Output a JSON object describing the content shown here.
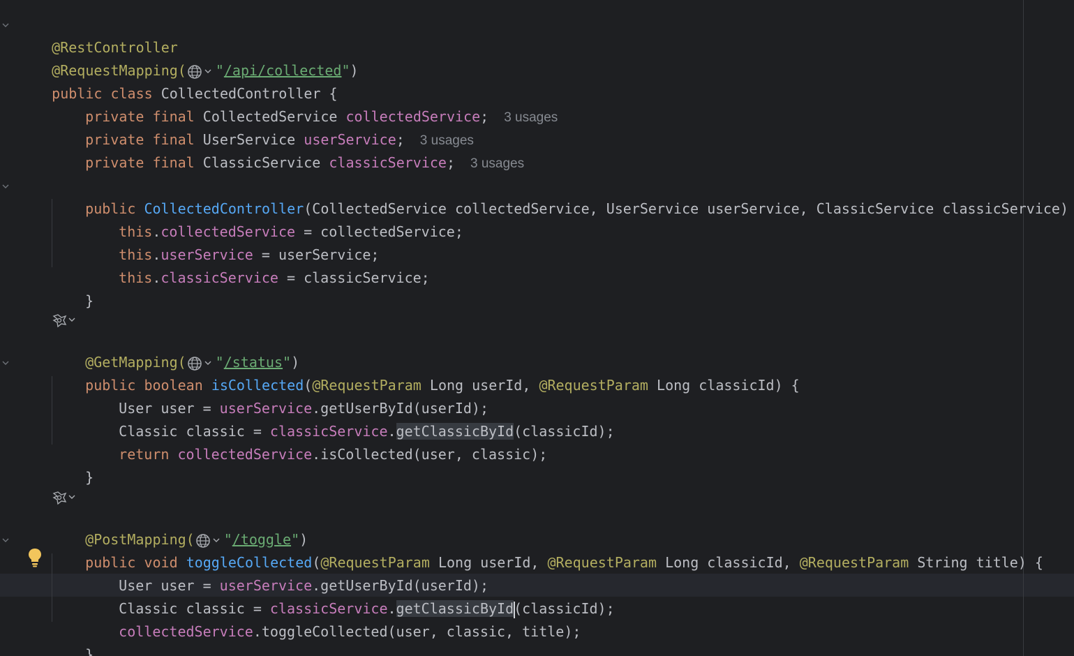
{
  "editor": {
    "language": "java",
    "lines": {
      "l1": [
        "@RestController"
      ],
      "l2": [
        "@RequestMapping(",
        "\"",
        "/api/collected",
        "\"",
        ")"
      ],
      "l3": [
        "public",
        " ",
        "class",
        " CollectedController {"
      ],
      "l4": [
        "private",
        " ",
        "final",
        " CollectedService ",
        "collectedService",
        ";"
      ],
      "l5": [
        "private",
        " ",
        "final",
        " UserService ",
        "userService",
        ";"
      ],
      "l6": [
        "private",
        " ",
        "final",
        " ClassicService ",
        "classicService",
        ";"
      ],
      "l8": [
        "public",
        " ",
        "CollectedController",
        "(CollectedService collectedService, UserService userService, ClassicService classicService) {"
      ],
      "l9": [
        "this",
        ".",
        "collectedService",
        " = collectedService;"
      ],
      "l10": [
        "this",
        ".",
        "userService",
        " = userService;"
      ],
      "l11": [
        "this",
        ".",
        "classicService",
        " = classicService;"
      ],
      "l12": [
        "}"
      ],
      "l14": [
        "@GetMapping(",
        "\"",
        "/status",
        "\"",
        ")"
      ],
      "l15": [
        "public",
        " ",
        "boolean",
        " ",
        "isCollected",
        "(",
        "@RequestParam",
        " Long userId, ",
        "@RequestParam",
        " Long classicId) {"
      ],
      "l16": [
        "User user = ",
        "userService",
        ".getUserById(userId);"
      ],
      "l17": [
        "Classic classic = ",
        "classicService",
        ".",
        "getClassicById",
        "(classicId);"
      ],
      "l18": [
        "return",
        " ",
        "collectedService",
        ".isCollected(user, classic);"
      ],
      "l19": [
        "}"
      ],
      "l21": [
        "@PostMapping(",
        "\"",
        "/toggle",
        "\"",
        ")"
      ],
      "l22": [
        "public",
        " ",
        "void",
        " ",
        "toggleCollected",
        "(",
        "@RequestParam",
        " Long userId, ",
        "@RequestParam",
        " Long classicId, ",
        "@RequestParam",
        " String title) {"
      ],
      "l23": [
        "User user = ",
        "userService",
        ".getUserById(userId);"
      ],
      "l24": [
        "Classic classic = ",
        "classicService",
        ".",
        "getClassicById",
        "(classicId);"
      ],
      "l25": [
        "collectedService",
        ".toggleCollected(user, classic, title);"
      ],
      "l26": [
        "}"
      ],
      "l27": [
        "}"
      ]
    },
    "usage_hints": {
      "collectedService": "3 usages",
      "userService": "3 usages",
      "classicService": "3 usages"
    },
    "icons": {
      "fold": "chevron-down-icon",
      "globe": "globe-icon",
      "endpoint": "endpoint-gutter-icon",
      "bulb": "lightbulb-icon"
    },
    "colors": {
      "background": "#1e1f22",
      "annotation": "#b3ae60",
      "keyword": "#cf8e6d",
      "field": "#c77dbb",
      "method_decl": "#56a8f5",
      "string": "#6aab73",
      "text": "#bcbec4",
      "hint": "#868a91"
    }
  }
}
